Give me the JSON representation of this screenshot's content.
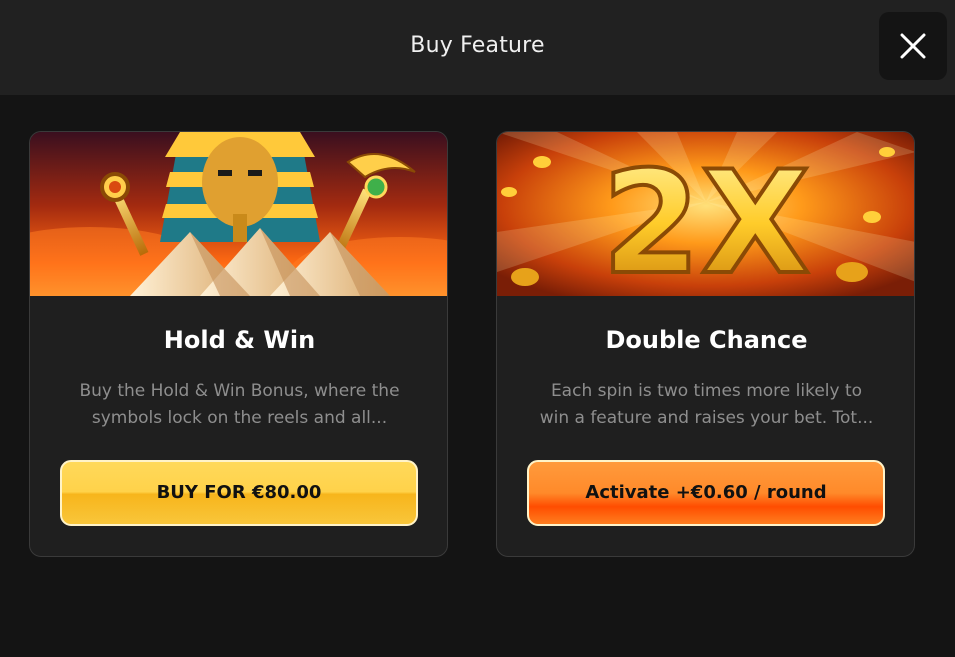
{
  "header": {
    "title": "Buy Feature",
    "close_icon": "close-icon"
  },
  "cards": [
    {
      "title": "Hold & Win",
      "description_lines": [
        "Buy the Hold & Win Bonus, where the",
        "symbols lock on the reels and all..."
      ],
      "button_label": "BUY FOR €80.00",
      "button_color": "#ffd24a",
      "banner_icon": "pharaoh-pyramids-image"
    },
    {
      "title": "Double Chance",
      "description_lines": [
        "Each spin is two times more likely to",
        "win a feature and raises your bet. Tot..."
      ],
      "button_label": "Activate +€0.60 / round",
      "button_color": "#ff7a1f",
      "banner_icon": "golden-2x-image",
      "banner_text": "2X"
    }
  ]
}
